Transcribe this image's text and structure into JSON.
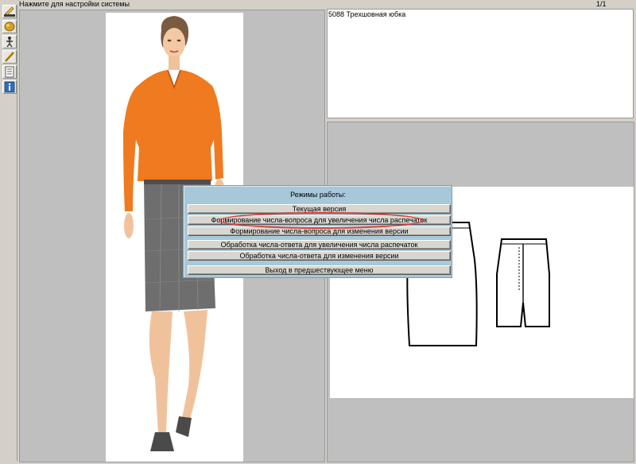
{
  "title_bar": {
    "hint": "Нажмите для настройки системы",
    "page_indicator": "1/1"
  },
  "toolbar": {
    "tools": [
      {
        "icon": "pencil-edit-icon"
      },
      {
        "icon": "fabric-roll-icon"
      },
      {
        "icon": "figure-icon"
      },
      {
        "icon": "ruler-pencil-icon"
      },
      {
        "icon": "document-list-icon"
      },
      {
        "icon": "info-icon"
      }
    ]
  },
  "description": {
    "text": "5088 Трехшовная юбка"
  },
  "dialog": {
    "title": "Режимы работы:",
    "buttons": [
      "Текущая версия",
      "Формирование числа-вопроса для увеличения числа распечаток",
      "Формирование числа-вопроса для изменения версии",
      "Обработка числа-ответа для увеличения числа распечаток",
      "Обработка числа-ответа для изменения версии",
      "Выход в предшествующее меню"
    ],
    "highlighted_index": 1
  },
  "colors": {
    "panel_gray": "#bfbfbf",
    "dialog_blue": "#a7c8d8",
    "highlight_red": "#e0352d",
    "blouse_orange": "#ef7a1f",
    "skirt_gray": "#6e6e6e"
  }
}
